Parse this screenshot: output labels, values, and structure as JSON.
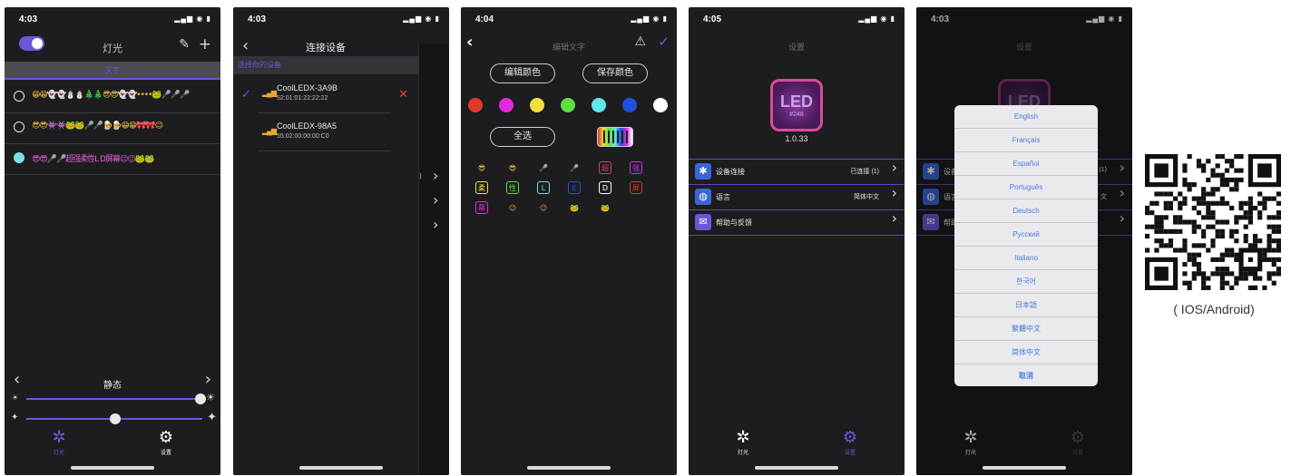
{
  "accent": "#6e56d8",
  "screen1": {
    "status": {
      "time": "4:03",
      "signal": "▂▄▆ • ▮"
    },
    "nav": {
      "title": "灯光",
      "edit_icon": "✎",
      "add_icon": "+"
    },
    "segment": "文字",
    "rows": [
      {
        "text": "😁😁👻👻⛄⛄🎄🎄😎😎👻👻••••🐸🎤🎤🎤"
      },
      {
        "text": "😎😎👾👾🐸🐸🎤🎤🍺🍺😁😁🎀🎀😉"
      },
      {
        "text": "😎😎🎤🎤超强柔性L D屏幕😉😉🐸🐸"
      }
    ],
    "mode": "静态",
    "tabs": [
      {
        "label": "灯光"
      },
      {
        "label": "设置"
      }
    ]
  },
  "screen2": {
    "status": {
      "time": "4:03"
    },
    "nav": {
      "title": "连接设备"
    },
    "section": "选择你的设备",
    "devices": [
      {
        "name": "CoolLEDX-3A9B",
        "mac": "52:01:01:22:22:22",
        "connected": true
      },
      {
        "name": "CoolLEDX-98A5",
        "mac": "55:02:00:00:00:C0",
        "connected": false
      }
    ],
    "bg_values": [
      "(1)",
      "文"
    ]
  },
  "screen3": {
    "status": {
      "time": "4:04"
    },
    "nav": {
      "title": "编辑文字"
    },
    "edit_color": "编辑颜色",
    "save_color": "保存颜色",
    "select_all": "全选",
    "colors": [
      "#e03a2a",
      "#e02ae0",
      "#f0e040",
      "#60e040",
      "#60e8e8",
      "#2050e0",
      "#ffffff"
    ],
    "glyphs": [
      {
        "t": "😎",
        "c": "#f0c040",
        "boxed": false
      },
      {
        "t": "😎",
        "c": "#f0c040",
        "boxed": false
      },
      {
        "t": "🎤",
        "c": "#c0c0c0",
        "boxed": false
      },
      {
        "t": "🎤",
        "c": "#c0c0c0",
        "boxed": false
      },
      {
        "t": "超",
        "c": "#e03a6a",
        "boxed": true
      },
      {
        "t": "强",
        "c": "#e02ae0",
        "boxed": true
      },
      {
        "t": "柔",
        "c": "#f0e040",
        "boxed": true
      },
      {
        "t": "性",
        "c": "#60e040",
        "boxed": true
      },
      {
        "t": "L",
        "c": "#60e8e8",
        "boxed": true
      },
      {
        "t": "E",
        "c": "#2050e0",
        "boxed": true
      },
      {
        "t": "D",
        "c": "#ffffff",
        "boxed": true
      },
      {
        "t": "屏",
        "c": "#e03a2a",
        "boxed": true
      },
      {
        "t": "幕",
        "c": "#e02ae0",
        "boxed": true
      },
      {
        "t": "😉",
        "c": "#d0a040",
        "boxed": false
      },
      {
        "t": "😉",
        "c": "#d0a040",
        "boxed": false
      },
      {
        "t": "🐸",
        "c": "#60a040",
        "boxed": false
      },
      {
        "t": "🐸",
        "c": "#60a040",
        "boxed": false
      }
    ]
  },
  "screen4": {
    "status": {
      "time": "4:05"
    },
    "nav": {
      "title": "设置"
    },
    "logo_text": "LED",
    "logo_sub": "#248",
    "version": "1.0.33",
    "rows": [
      {
        "label": "设备连接",
        "value": "已连接 (1)",
        "icon": "bluetooth-icon"
      },
      {
        "label": "语言",
        "value": "简体中文",
        "icon": "globe-icon"
      },
      {
        "label": "帮助与反馈",
        "value": "",
        "icon": "mail-icon"
      }
    ]
  },
  "screen5": {
    "status": {
      "time": "4:03"
    },
    "nav": {
      "title": "设置"
    },
    "row_labels": [
      "设备",
      "语言",
      "帮助"
    ],
    "row_values": [
      "(1)",
      "文"
    ],
    "languages": [
      "English",
      "Français",
      "Español",
      "Português",
      "Deutsch",
      "Русский",
      "Italiano",
      "한국어",
      "日本語",
      "繁體中文",
      "简体中文",
      "取消"
    ]
  },
  "qr": {
    "caption": "( IOS/Android)"
  }
}
